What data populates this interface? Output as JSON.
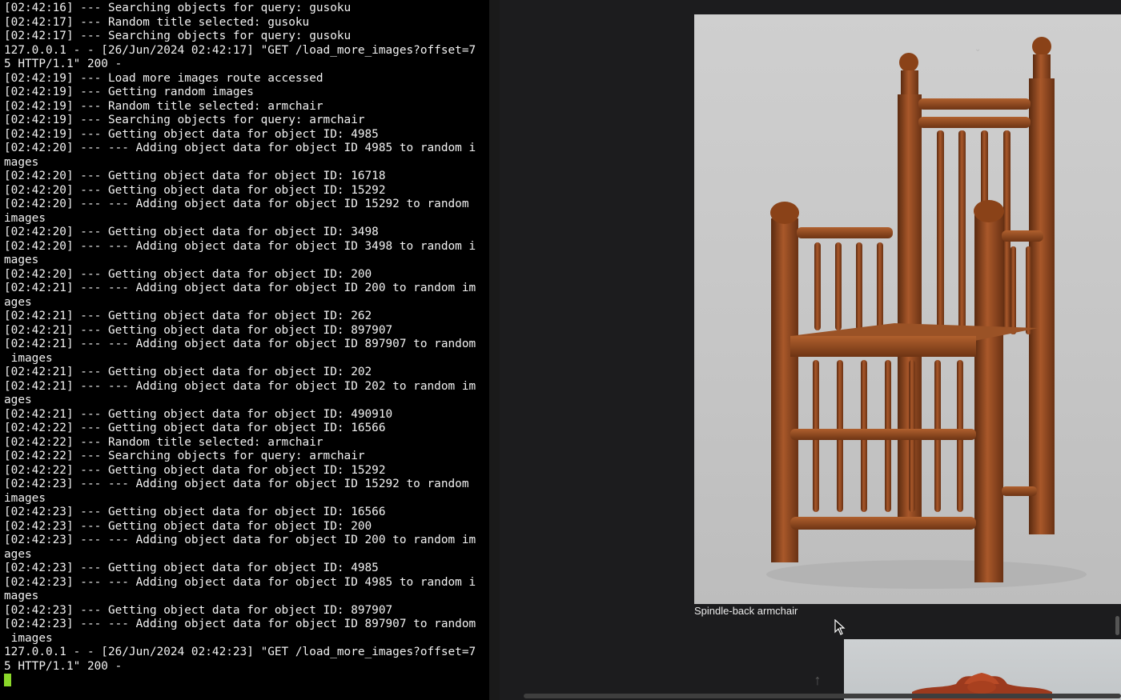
{
  "terminal": {
    "lines": [
      "[02:42:16] --- Searching objects for query: gusoku",
      "[02:42:17] --- Random title selected: gusoku",
      "[02:42:17] --- Searching objects for query: gusoku",
      "127.0.0.1 - - [26/Jun/2024 02:42:17] \"GET /load_more_images?offset=7",
      "5 HTTP/1.1\" 200 -",
      "[02:42:19] --- Load more images route accessed",
      "[02:42:19] --- Getting random images",
      "[02:42:19] --- Random title selected: armchair",
      "[02:42:19] --- Searching objects for query: armchair",
      "[02:42:19] --- Getting object data for object ID: 4985",
      "[02:42:20] --- --- Adding object data for object ID 4985 to random i",
      "mages",
      "[02:42:20] --- Getting object data for object ID: 16718",
      "[02:42:20] --- Getting object data for object ID: 15292",
      "[02:42:20] --- --- Adding object data for object ID 15292 to random",
      "images",
      "[02:42:20] --- Getting object data for object ID: 3498",
      "[02:42:20] --- --- Adding object data for object ID 3498 to random i",
      "mages",
      "[02:42:20] --- Getting object data for object ID: 200",
      "[02:42:21] --- --- Adding object data for object ID 200 to random im",
      "ages",
      "[02:42:21] --- Getting object data for object ID: 262",
      "[02:42:21] --- Getting object data for object ID: 897907",
      "[02:42:21] --- --- Adding object data for object ID 897907 to random",
      " images",
      "[02:42:21] --- Getting object data for object ID: 202",
      "[02:42:21] --- --- Adding object data for object ID 202 to random im",
      "ages",
      "[02:42:21] --- Getting object data for object ID: 490910",
      "[02:42:22] --- Getting object data for object ID: 16566",
      "[02:42:22] --- Random title selected: armchair",
      "[02:42:22] --- Searching objects for query: armchair",
      "[02:42:22] --- Getting object data for object ID: 15292",
      "[02:42:23] --- --- Adding object data for object ID 15292 to random",
      "images",
      "[02:42:23] --- Getting object data for object ID: 16566",
      "[02:42:23] --- Getting object data for object ID: 200",
      "[02:42:23] --- --- Adding object data for object ID 200 to random im",
      "ages",
      "[02:42:23] --- Getting object data for object ID: 4985",
      "[02:42:23] --- --- Adding object data for object ID 4985 to random i",
      "mages",
      "[02:42:23] --- Getting object data for object ID: 897907",
      "[02:42:23] --- --- Adding object data for object ID 897907 to random",
      " images",
      "127.0.0.1 - - [26/Jun/2024 02:42:23] \"GET /load_more_images?offset=7",
      "5 HTTP/1.1\" 200 -"
    ],
    "text_color": "#f2f2f2",
    "cursor_color": "#8bd72a"
  },
  "gallery": {
    "items": [
      {
        "caption": "Spindle-back armchair"
      }
    ],
    "scroll_top_icon": "↑",
    "chevron_icon": "⌄"
  }
}
